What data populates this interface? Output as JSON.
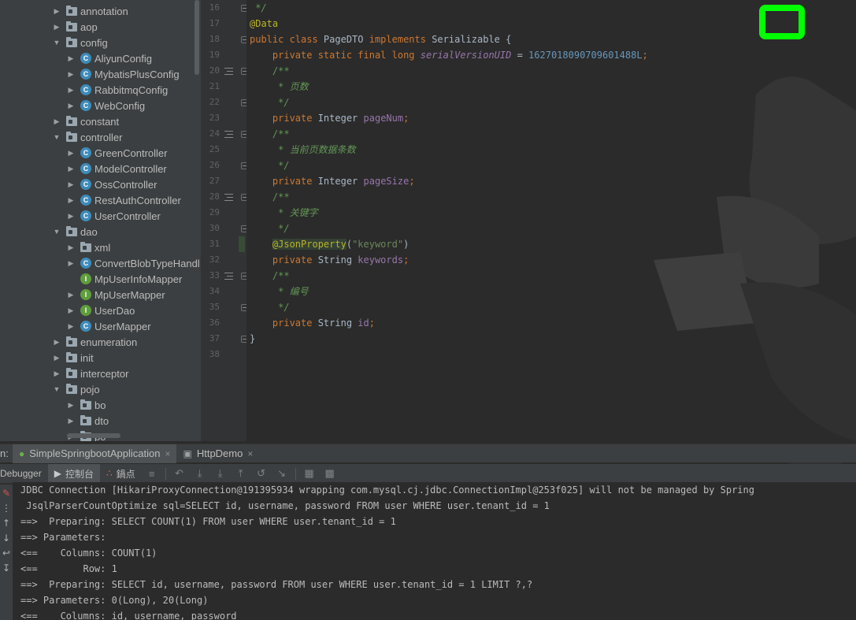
{
  "tree": {
    "items": [
      {
        "label": "annotation",
        "kind": "folder",
        "depth": 0,
        "expanded": false
      },
      {
        "label": "aop",
        "kind": "folder",
        "depth": 0,
        "expanded": false
      },
      {
        "label": "config",
        "kind": "folder",
        "depth": 0,
        "expanded": true
      },
      {
        "label": "AliyunConfig",
        "kind": "class",
        "depth": 1,
        "expanded": false
      },
      {
        "label": "MybatisPlusConfig",
        "kind": "class",
        "depth": 1,
        "expanded": false
      },
      {
        "label": "RabbitmqConfig",
        "kind": "class",
        "depth": 1,
        "expanded": false
      },
      {
        "label": "WebConfig",
        "kind": "class",
        "depth": 1,
        "expanded": false
      },
      {
        "label": "constant",
        "kind": "folder",
        "depth": 0,
        "expanded": false
      },
      {
        "label": "controller",
        "kind": "folder",
        "depth": 0,
        "expanded": true
      },
      {
        "label": "GreenController",
        "kind": "class",
        "depth": 1,
        "expanded": false
      },
      {
        "label": "ModelController",
        "kind": "class",
        "depth": 1,
        "expanded": false
      },
      {
        "label": "OssController",
        "kind": "class",
        "depth": 1,
        "expanded": false
      },
      {
        "label": "RestAuthController",
        "kind": "class",
        "depth": 1,
        "expanded": false
      },
      {
        "label": "UserController",
        "kind": "class",
        "depth": 1,
        "expanded": false
      },
      {
        "label": "dao",
        "kind": "folder",
        "depth": 0,
        "expanded": true
      },
      {
        "label": "xml",
        "kind": "folder",
        "depth": 1,
        "expanded": false
      },
      {
        "label": "ConvertBlobTypeHandl",
        "kind": "class",
        "depth": 1,
        "expanded": false
      },
      {
        "label": "MpUserInfoMapper",
        "kind": "iface",
        "depth": 1,
        "expanded": null
      },
      {
        "label": "MpUserMapper",
        "kind": "iface",
        "depth": 1,
        "expanded": false
      },
      {
        "label": "UserDao",
        "kind": "iface",
        "depth": 1,
        "expanded": false
      },
      {
        "label": "UserMapper",
        "kind": "class",
        "depth": 1,
        "expanded": false
      },
      {
        "label": "enumeration",
        "kind": "folder",
        "depth": 0,
        "expanded": false
      },
      {
        "label": "init",
        "kind": "folder",
        "depth": 0,
        "expanded": false
      },
      {
        "label": "interceptor",
        "kind": "folder",
        "depth": 0,
        "expanded": false
      },
      {
        "label": "pojo",
        "kind": "folder",
        "depth": 0,
        "expanded": true
      },
      {
        "label": "bo",
        "kind": "folder",
        "depth": 1,
        "expanded": false
      },
      {
        "label": "dto",
        "kind": "folder",
        "depth": 1,
        "expanded": false
      },
      {
        "label": "po",
        "kind": "folder",
        "depth": 1,
        "expanded": false
      }
    ]
  },
  "editor": {
    "lines": [
      {
        "num": "16",
        "html": " <span class=\"c\">*/</span>"
      },
      {
        "num": "17",
        "html": "<span class=\"a\">@Data</span>"
      },
      {
        "num": "18",
        "html": "<span class=\"k\">public class</span> PageDTO <span class=\"k\">implements</span> Serializable {"
      },
      {
        "num": "19",
        "html": "    <span class=\"k\">private static final long</span> <span class=\"fi\">serialVersionUID</span> = <span class=\"n\">1627018090709601488L</span><span class=\"k\">;</span>"
      },
      {
        "num": "20",
        "html": "    <span class=\"cf\">/**</span>"
      },
      {
        "num": "21",
        "html": "<span class=\"c\">     * 页数</span>"
      },
      {
        "num": "22",
        "html": "<span class=\"c\">     */</span>"
      },
      {
        "num": "23",
        "html": "    <span class=\"k\">private</span> Integer <span class=\"f\">pageNum</span><span class=\"k\">;</span>"
      },
      {
        "num": "24",
        "html": "    <span class=\"cf\">/**</span>"
      },
      {
        "num": "25",
        "html": "<span class=\"c\">     * 当前页数据条数</span>"
      },
      {
        "num": "26",
        "html": "<span class=\"c\">     */</span>"
      },
      {
        "num": "27",
        "html": "    <span class=\"k\">private</span> Integer <span class=\"f\">pageSize</span><span class=\"k\">;</span>"
      },
      {
        "num": "28",
        "html": "    <span class=\"cf\">/**</span>"
      },
      {
        "num": "29",
        "html": "<span class=\"c\">     * 关键字</span>"
      },
      {
        "num": "30",
        "html": "<span class=\"c\">     */</span>"
      },
      {
        "num": "31",
        "html": "    <span class=\"a hl\">@JsonProperty</span>(<span class=\"s\">\"keyword\"</span>)"
      },
      {
        "num": "32",
        "html": "    <span class=\"k\">private</span> String <span class=\"f\">keywords</span><span class=\"k\">;</span>"
      },
      {
        "num": "33",
        "html": "    <span class=\"cf\">/**</span>"
      },
      {
        "num": "34",
        "html": "<span class=\"c\">     * 编号</span>"
      },
      {
        "num": "35",
        "html": "<span class=\"c\">     */</span>"
      },
      {
        "num": "36",
        "html": "    <span class=\"k\">private</span> String <span class=\"f\">id</span><span class=\"k\">;</span>"
      },
      {
        "num": "37",
        "html": "}"
      },
      {
        "num": "38",
        "html": ""
      }
    ],
    "doc_mark_lines": [
      "20",
      "24",
      "28",
      "33"
    ],
    "fold_lines": [
      "16",
      "18",
      "20",
      "22",
      "24",
      "26",
      "28",
      "30",
      "33",
      "35",
      "37"
    ]
  },
  "run_panel": {
    "prefix": "n:",
    "tabs": [
      {
        "label": "SimpleSpringbootApplication",
        "icon": "spring-boot-icon",
        "active": true
      },
      {
        "label": "HttpDemo",
        "icon": "window-icon",
        "active": false
      }
    ],
    "toolbar": {
      "debugger_label": "Debugger",
      "console_label": "控制台",
      "breakpoints_label": "鍋点"
    },
    "console_lines": [
      "JDBC Connection [HikariProxyConnection@191395934 wrapping com.mysql.cj.jdbc.ConnectionImpl@253f025] will not be managed by Spring",
      " JsqlParserCountOptimize sql=SELECT id, username, password FROM user WHERE user.tenant_id = 1",
      "==>  Preparing: SELECT COUNT(1) FROM user WHERE user.tenant_id = 1",
      "==> Parameters: ",
      "<==    Columns: COUNT(1)",
      "<==        Row: 1",
      "==>  Preparing: SELECT id, username, password FROM user WHERE user.tenant_id = 1 LIMIT ?,?",
      "==> Parameters: 0(Long), 20(Long)",
      "<==    Columns: id, username, password"
    ]
  },
  "colors": {
    "tree_bg": "#3c3f41",
    "editor_bg": "#2b2b2b",
    "keyword": "#cc7832",
    "annotation": "#bbb529",
    "comment": "#629755",
    "number": "#6897bb",
    "field": "#9876aa",
    "string": "#6a8759",
    "badge_green": "#00ff00"
  }
}
